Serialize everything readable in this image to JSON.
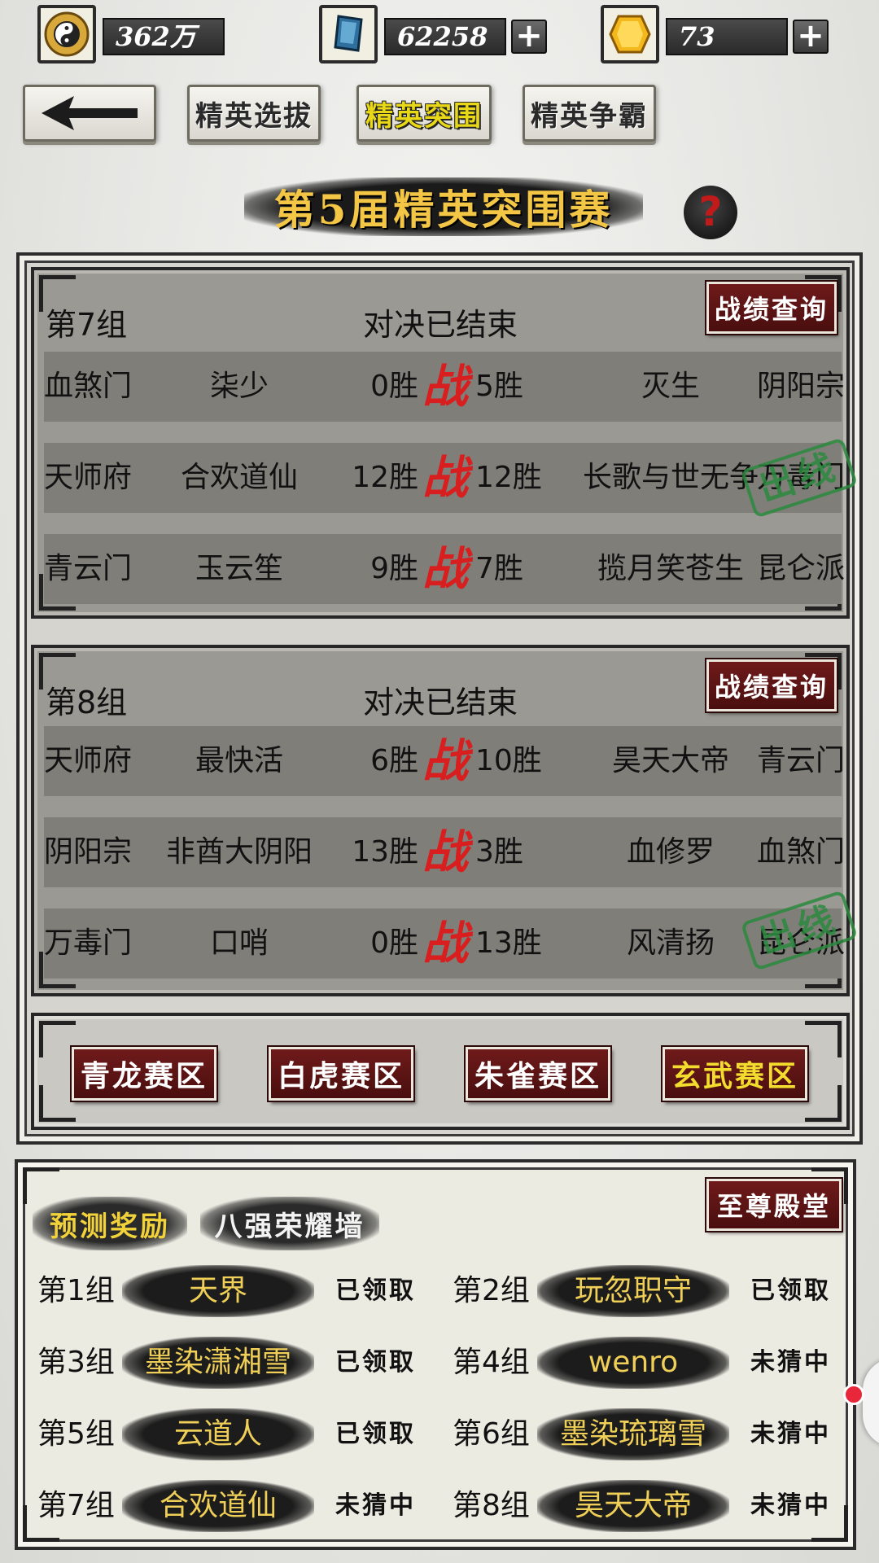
{
  "resources": [
    {
      "icon": "yin-yang-coin-icon",
      "value": "362万",
      "has_plus": false
    },
    {
      "icon": "blue-crystal-icon",
      "value": "62258",
      "has_plus": true
    },
    {
      "icon": "gold-ingot-icon",
      "value": "73",
      "has_plus": true
    }
  ],
  "nav": {
    "back_icon": "back-arrow-icon",
    "tabs": [
      "精英选拔",
      "精英突围",
      "精英争霸"
    ],
    "active_tab": "精英突围"
  },
  "title": "第5届精英突围赛",
  "help_label": "?",
  "groups": [
    {
      "name": "第7组",
      "status": "对决已结束",
      "record_button": "战绩查询",
      "matches": [
        {
          "sect1": "血煞门",
          "player1": "柒少",
          "wins1": "0胜",
          "vs": "战",
          "wins2": "5胜",
          "player2": "灭生",
          "sect2": "阴阳宗",
          "stamp": ""
        },
        {
          "sect1": "天师府",
          "player1": "合欢道仙",
          "wins1": "12胜",
          "vs": "战",
          "wins2": "12胜",
          "player2": "长歌与世无争",
          "sect2": "万毒门",
          "stamp": "出线"
        },
        {
          "sect1": "青云门",
          "player1": "玉云笙",
          "wins1": "9胜",
          "vs": "战",
          "wins2": "7胜",
          "player2": "揽月笑苍生",
          "sect2": "昆仑派",
          "stamp": ""
        }
      ]
    },
    {
      "name": "第8组",
      "status": "对决已结束",
      "record_button": "战绩查询",
      "matches": [
        {
          "sect1": "天师府",
          "player1": "最快活",
          "wins1": "6胜",
          "vs": "战",
          "wins2": "10胜",
          "player2": "昊天大帝",
          "sect2": "青云门",
          "stamp": ""
        },
        {
          "sect1": "阴阳宗",
          "player1": "非酋大阴阳",
          "wins1": "13胜",
          "vs": "战",
          "wins2": "3胜",
          "player2": "血修罗",
          "sect2": "血煞门",
          "stamp": ""
        },
        {
          "sect1": "万毒门",
          "player1": "口哨",
          "wins1": "0胜",
          "vs": "战",
          "wins2": "13胜",
          "player2": "风清扬",
          "sect2": "昆仑派",
          "stamp": "出线"
        }
      ]
    }
  ],
  "regions": [
    {
      "label": "青龙赛区",
      "active": false
    },
    {
      "label": "白虎赛区",
      "active": false
    },
    {
      "label": "朱雀赛区",
      "active": false
    },
    {
      "label": "玄武赛区",
      "active": true
    }
  ],
  "bottom": {
    "tabs": [
      "预测奖励",
      "八强荣耀墙"
    ],
    "active_tab": "预测奖励",
    "hall_button": "至尊殿堂",
    "predictions": [
      {
        "group": "第1组",
        "name": "天界",
        "status": "已领取"
      },
      {
        "group": "第2组",
        "name": "玩忽职守",
        "status": "已领取"
      },
      {
        "group": "第3组",
        "name": "墨染潇湘雪",
        "status": "已领取"
      },
      {
        "group": "第4组",
        "name": "wenro",
        "status": "未猜中"
      },
      {
        "group": "第5组",
        "name": "云道人",
        "status": "已领取"
      },
      {
        "group": "第6组",
        "name": "墨染琉璃雪",
        "status": "未猜中"
      },
      {
        "group": "第7组",
        "name": "合欢道仙",
        "status": "未猜中"
      },
      {
        "group": "第8组",
        "name": "昊天大帝",
        "status": "未猜中"
      }
    ]
  },
  "colors": {
    "vs_red": "#d81e1e",
    "stamp_green": "#2b8a3e",
    "gold_text": "#f0cf58",
    "button_maroon": "#5c1414"
  }
}
